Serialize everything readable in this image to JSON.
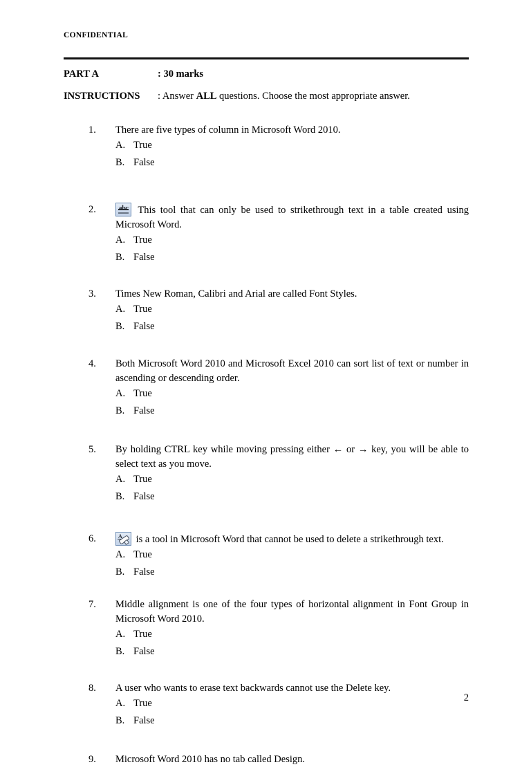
{
  "document": {
    "classification": "CONFIDENTIAL",
    "page_number": "2"
  },
  "header": {
    "part_label": "PART A",
    "part_value": ": 30 marks",
    "instructions_label": "INSTRUCTIONS",
    "instructions_prefix": ": Answer ",
    "instructions_emphasis": "ALL",
    "instructions_suffix": " questions. Choose the most appropriate answer."
  },
  "options": {
    "a_letter": "A.",
    "a_text": "True",
    "b_letter": "B.",
    "b_text": "False"
  },
  "questions": [
    {
      "number": "1.",
      "text": "There are five types of column in Microsoft Word 2010.",
      "icon": null,
      "justify": false,
      "has_options": true
    },
    {
      "number": "2.",
      "text": "This tool that can only be used to strikethrough text in a table created using Microsoft Word.",
      "icon": "strikethrough-icon",
      "justify": true,
      "has_options": true
    },
    {
      "number": "3.",
      "text": "Times New Roman, Calibri and Arial are called Font Styles.",
      "icon": null,
      "justify": false,
      "has_options": true
    },
    {
      "number": "4.",
      "text": "Both Microsoft Word 2010 and Microsoft Excel 2010 can sort list of text or number in ascending or descending order.",
      "icon": null,
      "justify": true,
      "has_options": true
    },
    {
      "number": "5.",
      "text": "By holding CTRL key while moving pressing either ← or → key, you will be able to select text as you move.",
      "icon": null,
      "justify": true,
      "has_options": true
    },
    {
      "number": "6.",
      "text": "is a tool in Microsoft Word that cannot be used to delete a strikethrough text.",
      "icon": "clear-formatting-icon",
      "justify": false,
      "has_options": true
    },
    {
      "number": "7.",
      "text": "Middle alignment is one of the four types of horizontal alignment in Font Group in Microsoft Word 2010.",
      "icon": null,
      "justify": true,
      "has_options": true
    },
    {
      "number": "8.",
      "text": "A user who wants to erase text backwards cannot use the Delete key.",
      "icon": null,
      "justify": false,
      "has_options": true
    },
    {
      "number": "9.",
      "text": "Microsoft Word 2010 has no tab called Design.",
      "icon": null,
      "justify": false,
      "has_options": false
    }
  ]
}
